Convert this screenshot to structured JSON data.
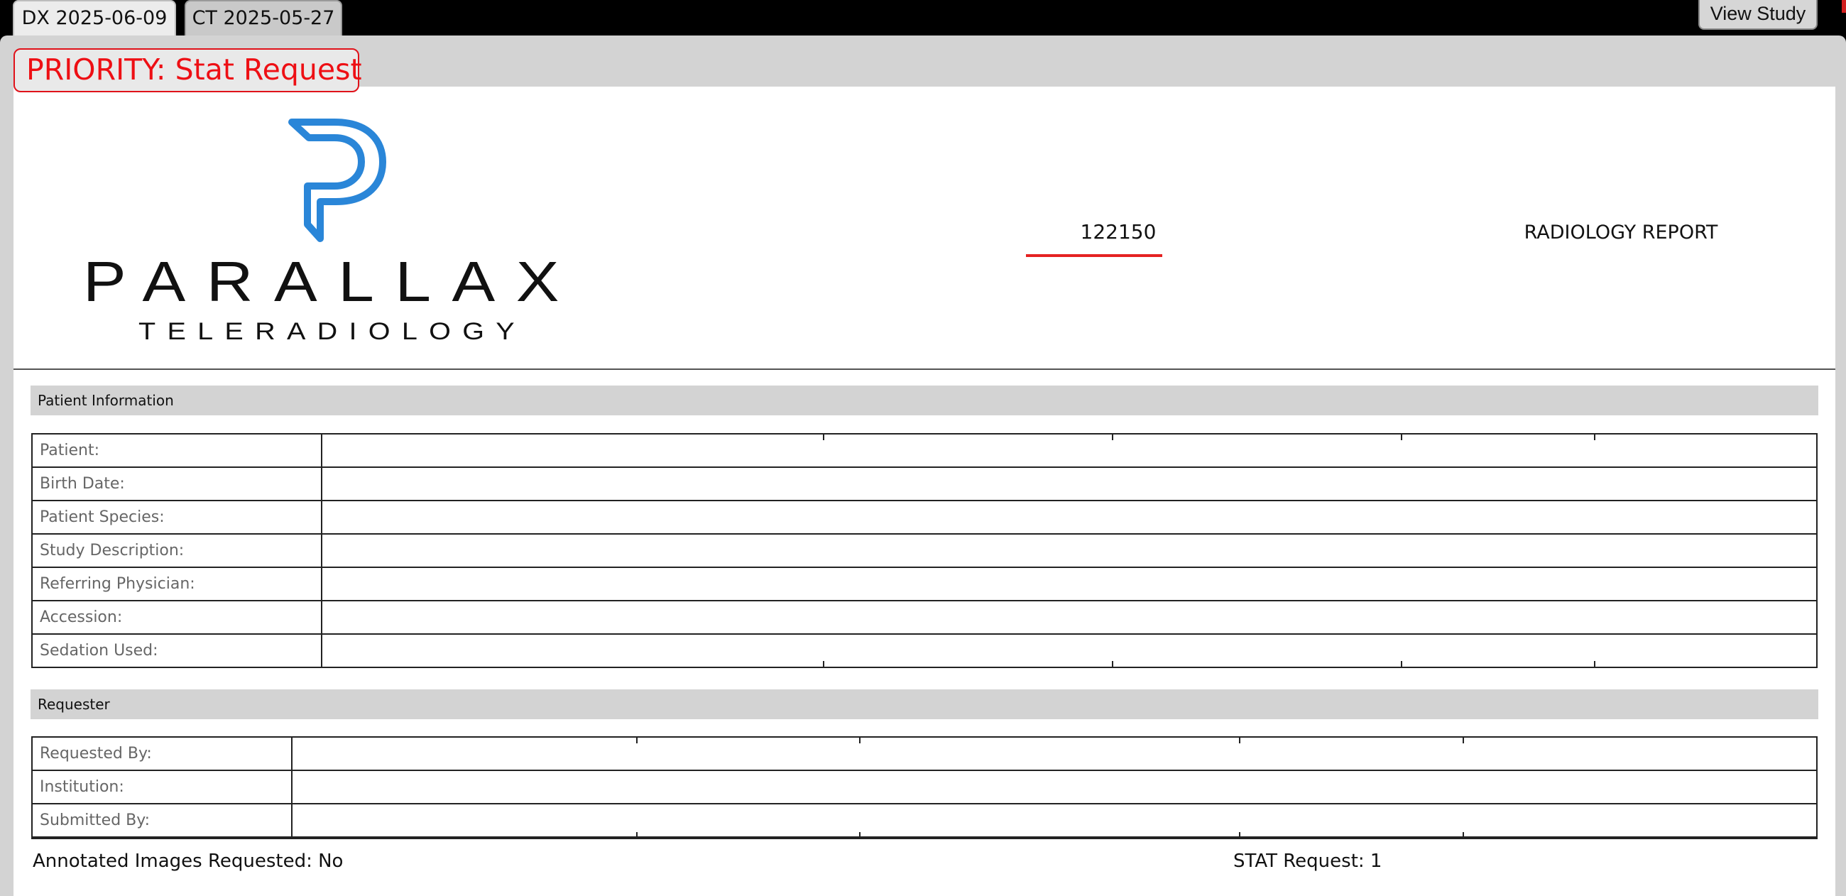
{
  "tabs": [
    {
      "label": "DX 2025-06-09",
      "active": true
    },
    {
      "label": "CT 2025-05-27",
      "active": false
    }
  ],
  "toolbar": {
    "view_study_label": "View Study"
  },
  "priority": {
    "label": "PRIORITY: Stat Request",
    "color": "#ee0f14"
  },
  "header": {
    "logo": {
      "name": "parallax-teleradiology-logo",
      "wordmark": "PARALLAX",
      "tagline": "TELERADIOLOGY",
      "brand_color": "#2a86d8"
    },
    "report_id": "122150",
    "report_title": "RADIOLOGY REPORT"
  },
  "patient_information": {
    "section_title": "Patient Information",
    "rows": [
      {
        "label": "Patient:",
        "value": ""
      },
      {
        "label": "Birth Date:",
        "value": ""
      },
      {
        "label": "Patient Species:",
        "value": ""
      },
      {
        "label": "Study Description:",
        "value": ""
      },
      {
        "label": "Referring Physician:",
        "value": ""
      },
      {
        "label": "Accession:",
        "value": ""
      },
      {
        "label": "Sedation Used:",
        "value": ""
      }
    ]
  },
  "requester": {
    "section_title": "Requester",
    "rows": [
      {
        "label": "Requested By:",
        "value": ""
      },
      {
        "label": "Institution:",
        "value": ""
      },
      {
        "label": "Submitted By:",
        "value": ""
      }
    ]
  },
  "footer": {
    "annotated_images": "Annotated Images Requested: No",
    "stat_request": "STAT Request: 1"
  }
}
